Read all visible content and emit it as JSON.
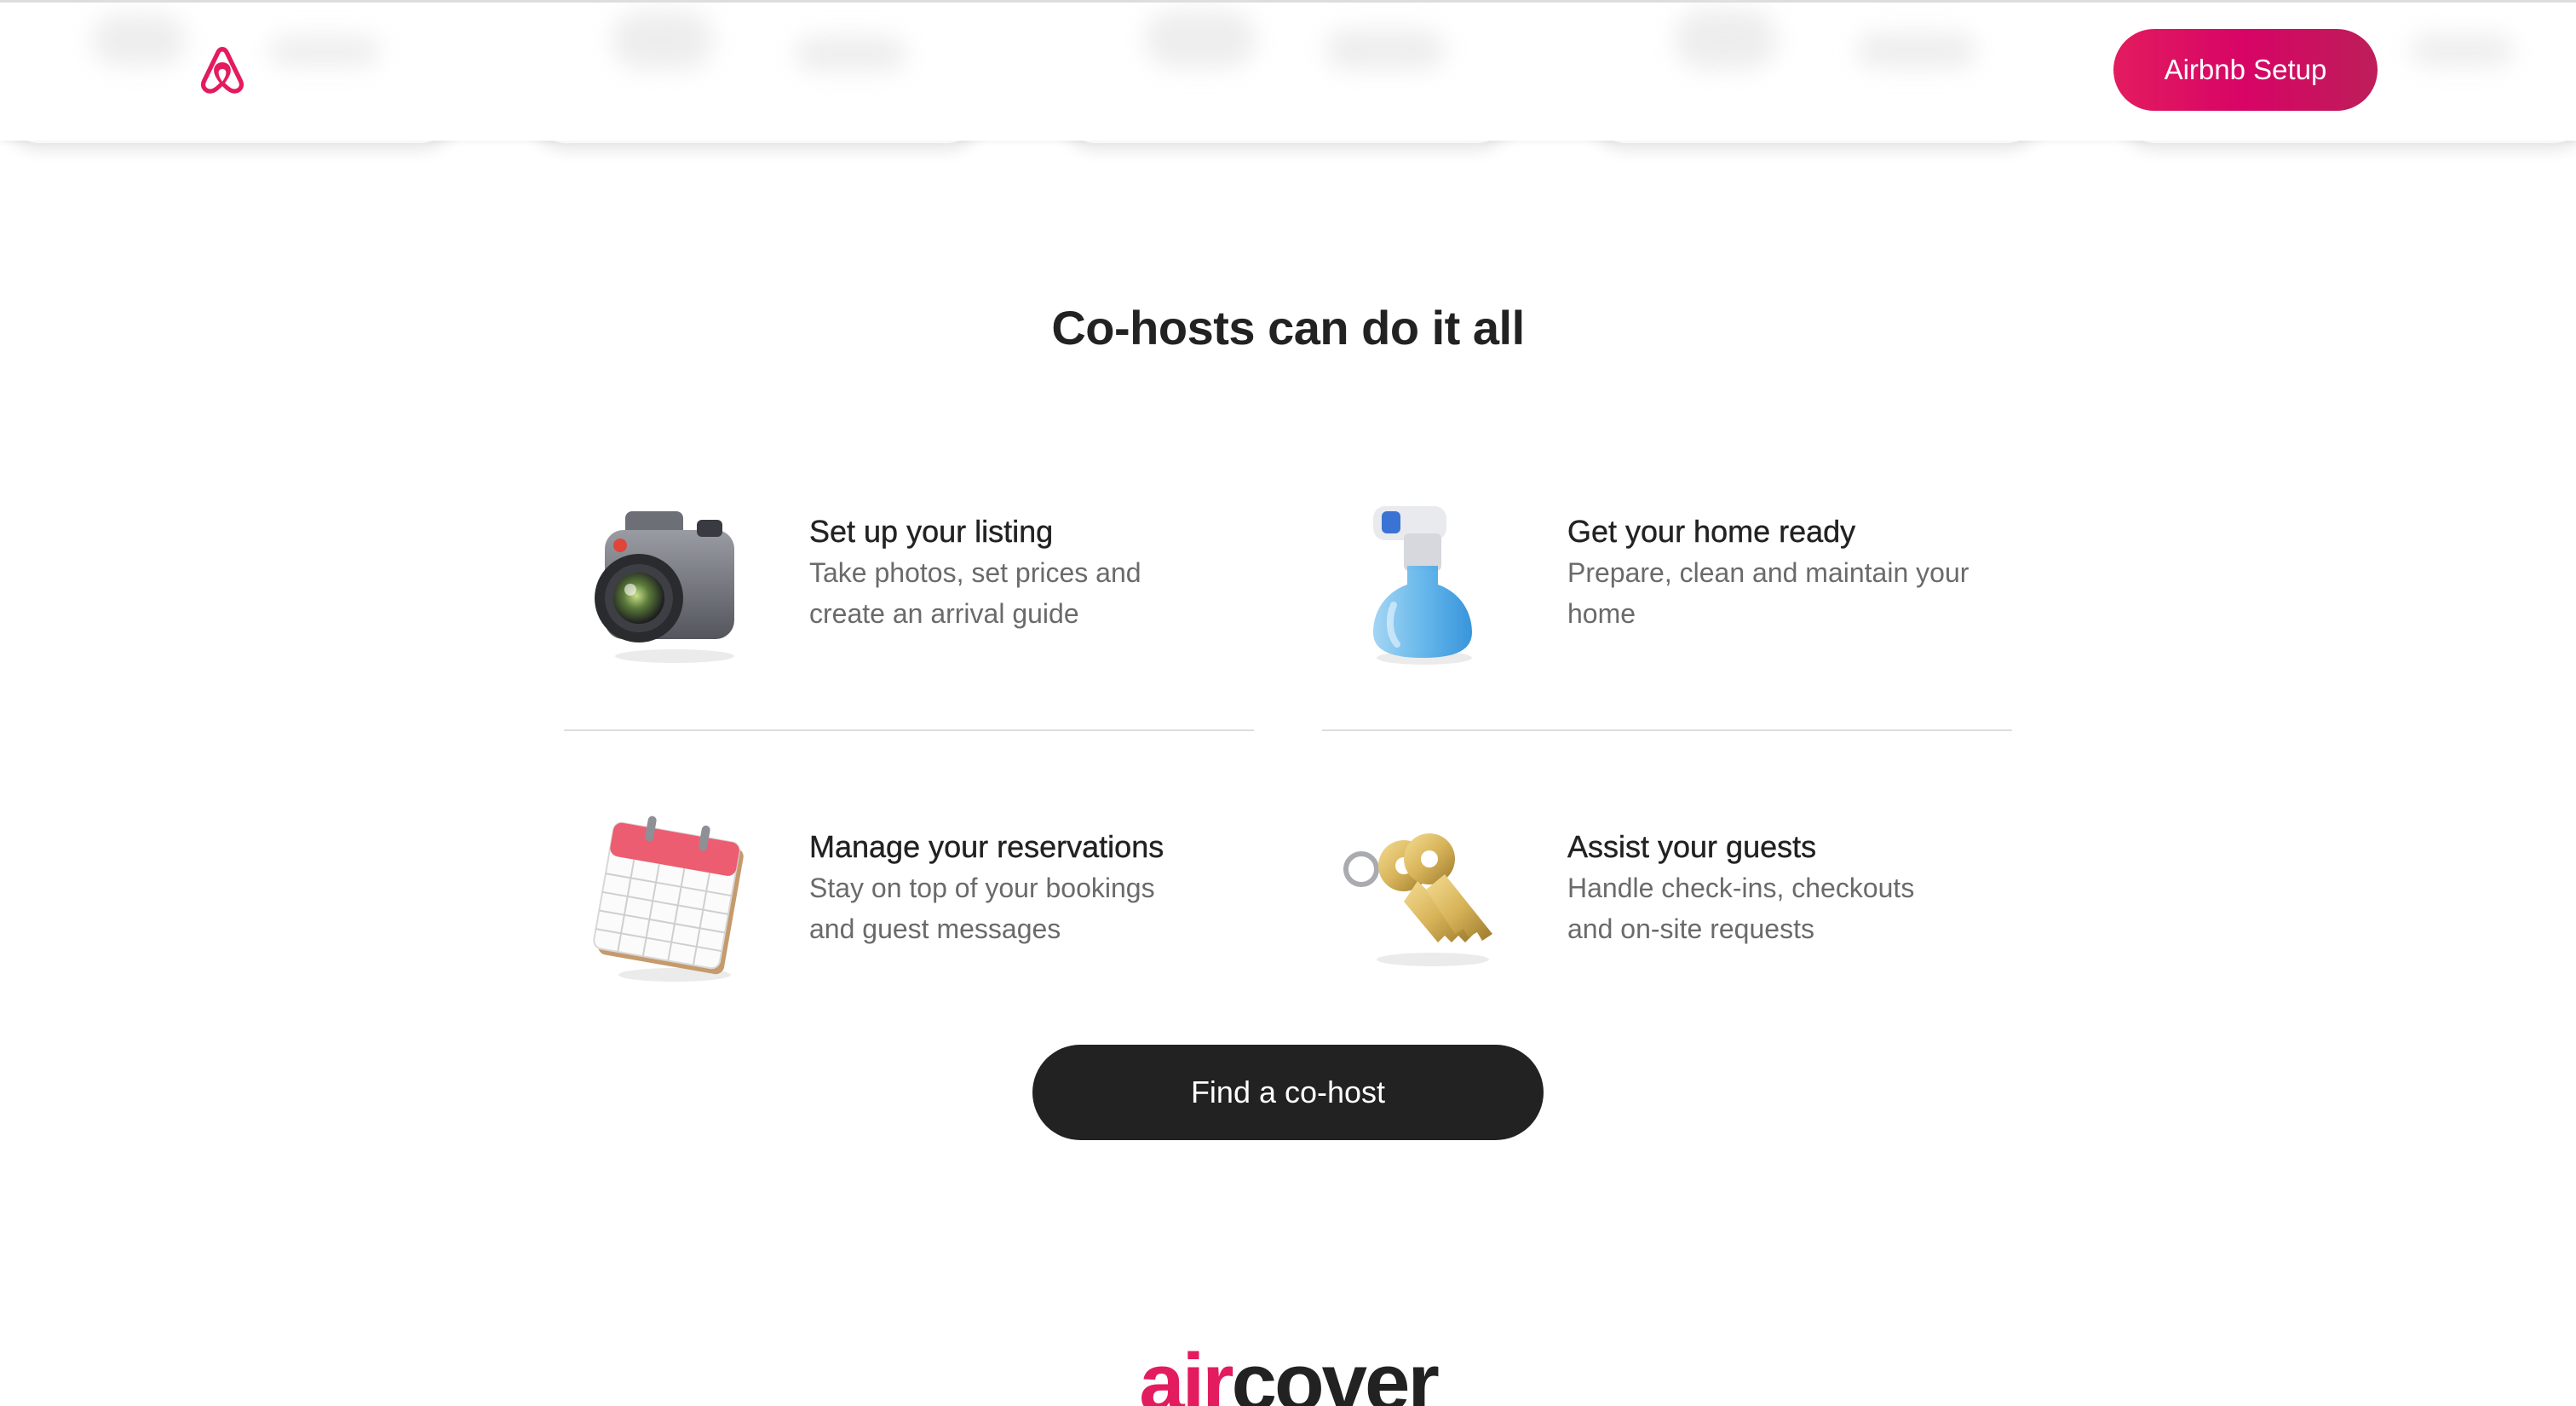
{
  "header": {
    "logo": "airbnb-logo-icon",
    "setup_label": "Airbnb Setup"
  },
  "main": {
    "title": "Co-hosts can do it all",
    "features": [
      {
        "icon": "camera-icon",
        "title": "Set up your listing",
        "description_line1": "Take photos, set prices and",
        "description_line2": "create an arrival guide"
      },
      {
        "icon": "spray-bottle-icon",
        "title": "Get your home ready",
        "description_line1": "Prepare, clean and maintain your",
        "description_line2": "home"
      },
      {
        "icon": "calendar-icon",
        "title": "Manage your reservations",
        "description_line1": "Stay on top of your bookings",
        "description_line2": "and guest messages"
      },
      {
        "icon": "keys-icon",
        "title": "Assist your guests",
        "description_line1": "Handle check-ins, checkouts",
        "description_line2": "and on-site requests"
      }
    ],
    "cta_label": "Find a co-host"
  },
  "aircover": {
    "air": "air",
    "cover": "cover"
  },
  "colors": {
    "brand": "#e31c5f",
    "text": "#222222",
    "muted": "#6a6a6a",
    "divider": "#dddddd"
  }
}
